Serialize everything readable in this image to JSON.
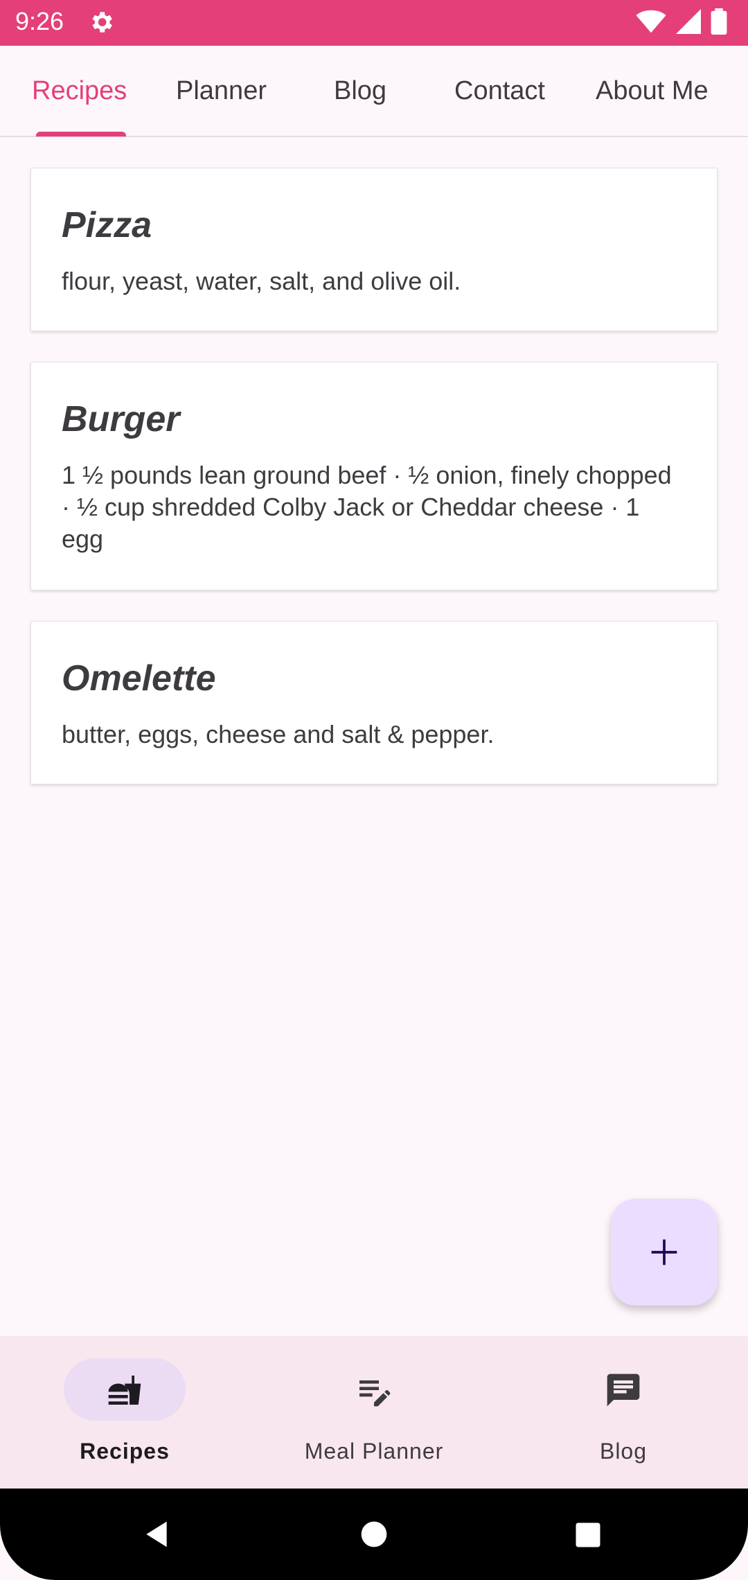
{
  "status_bar": {
    "time": "9:26",
    "icons": [
      "gear-icon",
      "wifi-icon",
      "signal-icon",
      "battery-icon"
    ]
  },
  "top_tabs": [
    {
      "label": "Recipes",
      "active": true
    },
    {
      "label": "Planner",
      "active": false
    },
    {
      "label": "Blog",
      "active": false
    },
    {
      "label": "Contact",
      "active": false
    },
    {
      "label": "About Me",
      "active": false
    }
  ],
  "recipes": [
    {
      "title": "Pizza",
      "ingredients": "flour, yeast, water, salt, and olive oil."
    },
    {
      "title": "Burger",
      "ingredients": "1 ½ pounds lean ground beef · ½ onion, finely chopped · ½ cup shredded Colby Jack or Cheddar cheese · 1 egg"
    },
    {
      "title": "Omelette",
      "ingredients": "butter, eggs, cheese and salt & pepper."
    }
  ],
  "fab": {
    "icon": "plus-icon"
  },
  "bottom_nav": [
    {
      "label": "Recipes",
      "icon": "burger-drink-icon",
      "active": true
    },
    {
      "label": "Meal Planner",
      "icon": "edit-list-icon",
      "active": false
    },
    {
      "label": "Blog",
      "icon": "chat-bubble-icon",
      "active": false
    }
  ],
  "colors": {
    "accent": "#E43F78",
    "background": "#FDF7FB",
    "fab": "#EADDFF",
    "bottom_nav": "#F9E7F0",
    "nav_pill": "#EBDCF4"
  }
}
